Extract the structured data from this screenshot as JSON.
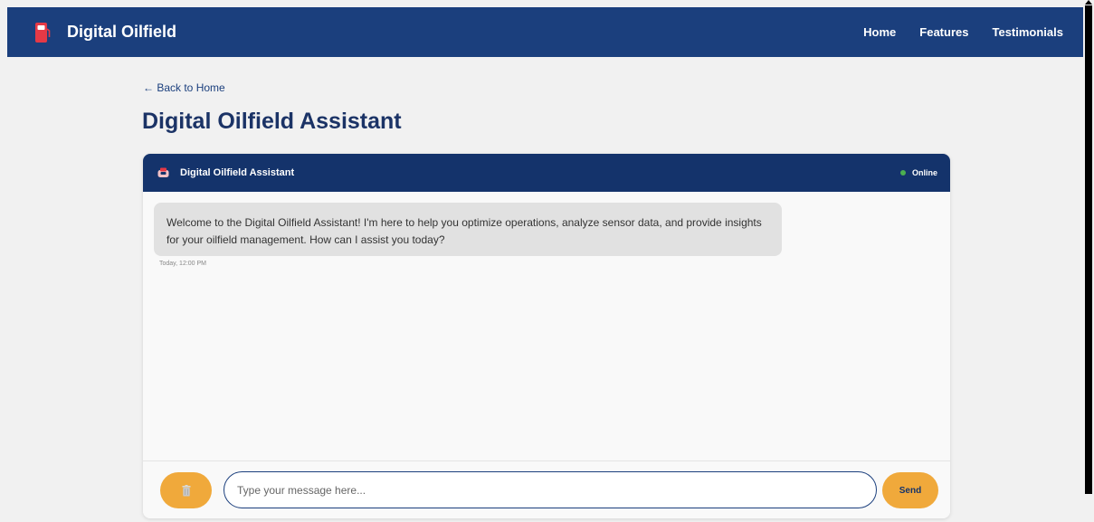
{
  "app": {
    "brand_name": "Digital Oilfield",
    "brand_icon": "fuel-pump-icon"
  },
  "nav": {
    "items": [
      {
        "label": "Home"
      },
      {
        "label": "Features"
      },
      {
        "label": "Testimonials"
      }
    ]
  },
  "page": {
    "back_link": "← Back to Home",
    "title": "Digital Oilfield Assistant"
  },
  "chat": {
    "header_title": "Digital Oilfield Assistant",
    "header_icon": "fuel-pump-icon",
    "status": "Online",
    "status_color": "#4caf50",
    "messages": [
      {
        "text": "Welcome to the Digital Oilfield Assistant! I'm here to help you optimize operations, analyze sensor data, and provide insights for your oilfield management. How can I assist you today?",
        "timestamp": "Today, 12:00 PM"
      }
    ],
    "input": {
      "placeholder": "Type your message here...",
      "value": ""
    },
    "clear_icon": "trash-icon",
    "send_label": "Send"
  },
  "colors": {
    "primary": "#1b3f7d",
    "header_dark": "#14336b",
    "accent": "#f0a93b",
    "bubble": "#e1e1e1"
  }
}
